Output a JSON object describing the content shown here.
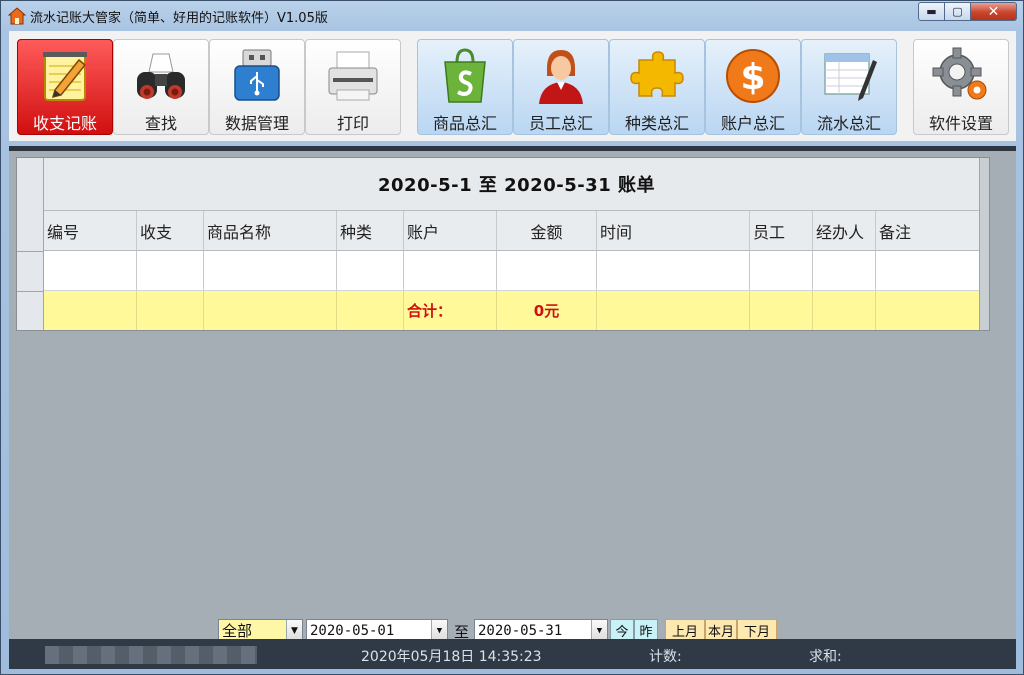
{
  "window": {
    "title": "流水记账大管家（简单、好用的记账软件）V1.05版",
    "controls": {
      "minimize": "▬",
      "maximize": "▢",
      "close": "✕"
    }
  },
  "toolbar": {
    "buttons": [
      {
        "label": "收支记账",
        "icon": "notepad-pencil-icon",
        "active": true
      },
      {
        "label": "查找",
        "icon": "binoculars-icon"
      },
      {
        "label": "数据管理",
        "icon": "usb-drive-icon"
      },
      {
        "label": "打印",
        "icon": "printer-icon"
      },
      {
        "label": "商品总汇",
        "icon": "shopping-bag-icon"
      },
      {
        "label": "员工总汇",
        "icon": "employee-icon"
      },
      {
        "label": "种类总汇",
        "icon": "puzzle-icon"
      },
      {
        "label": "账户总汇",
        "icon": "dollar-coin-icon"
      },
      {
        "label": "流水总汇",
        "icon": "ledger-pen-icon"
      },
      {
        "label": "软件设置",
        "icon": "gear-icon"
      }
    ]
  },
  "grid": {
    "title": "2020-5-1  至  2020-5-31  账单",
    "columns": [
      "编号",
      "收支",
      "商品名称",
      "种类",
      "账户",
      "金额",
      "时间",
      "员工",
      "经办人",
      "备注"
    ],
    "summary": {
      "label": "合计：",
      "amount": "0元"
    }
  },
  "filter": {
    "type_value": "全部",
    "start_date": "2020-05-01",
    "to_label": "至",
    "end_date": "2020-05-31",
    "quick_buttons": [
      "今",
      "昨"
    ],
    "month_buttons": [
      "上月",
      "本月",
      "下月"
    ]
  },
  "status": {
    "datetime": "2020年05月18日  14:35:23",
    "count_label": "计数:",
    "sum_label": "求和:"
  },
  "colors": {
    "active_button": "#e01010",
    "summary_row": "#fff99a",
    "summary_text": "#d01010",
    "statusbar": "#2f3a46"
  }
}
